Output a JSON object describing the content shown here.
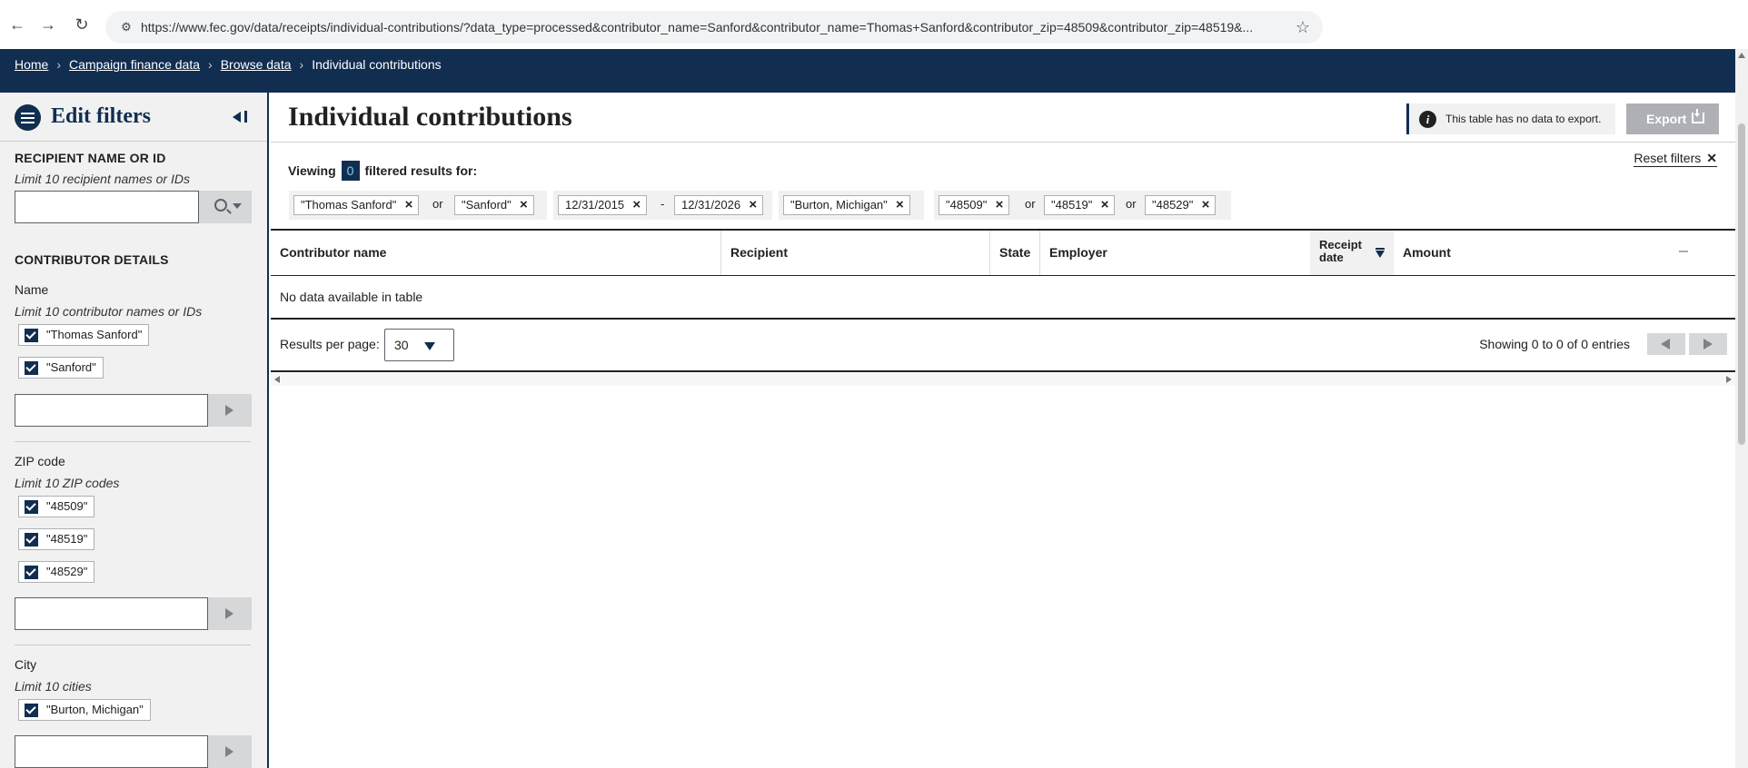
{
  "browser": {
    "url": "https://www.fec.gov/data/receipts/individual-contributions/?data_type=processed&contributor_name=Sanford&contributor_name=Thomas+Sanford&contributor_zip=48509&contributor_zip=48519&..."
  },
  "breadcrumb": {
    "items": [
      "Home",
      "Campaign finance data",
      "Browse data"
    ],
    "current": "Individual contributions"
  },
  "sidebar": {
    "title": "Edit filters",
    "recipient": {
      "heading": "RECIPIENT NAME OR ID",
      "hint": "Limit 10 recipient names or IDs",
      "value": ""
    },
    "contributor": {
      "heading": "CONTRIBUTOR DETAILS",
      "name": {
        "label": "Name",
        "hint": "Limit 10 contributor names or IDs",
        "checked": [
          "\"Thomas Sanford\"",
          "\"Sanford\""
        ],
        "value": ""
      },
      "zip": {
        "label": "ZIP code",
        "hint": "Limit 10 ZIP codes",
        "checked": [
          "\"48509\"",
          "\"48519\"",
          "\"48529\""
        ],
        "value": ""
      },
      "city": {
        "label": "City",
        "hint": "Limit 10 cities",
        "checked": [
          "\"Burton, Michigan\""
        ],
        "value": ""
      }
    }
  },
  "main": {
    "title": "Individual contributions",
    "export_message": "This table has no data to export.",
    "export_label": "Export",
    "viewing_prefix": "Viewing",
    "count": "0",
    "viewing_suffix": "filtered results for:",
    "reset_label": "Reset filters",
    "tags": {
      "names": [
        "\"Thomas Sanford\"",
        "\"Sanford\""
      ],
      "dates": [
        "12/31/2015",
        "12/31/2026"
      ],
      "city": "\"Burton, Michigan\"",
      "zips": [
        "\"48509\"",
        "\"48519\"",
        "\"48529\""
      ],
      "or": "or",
      "dash": "-"
    },
    "table": {
      "columns": [
        "Contributor name",
        "Recipient",
        "State",
        "Employer",
        "Receipt date",
        "Amount"
      ],
      "sort_column": "Receipt date",
      "sort_direction": "descending",
      "empty_message": "No data available in table"
    },
    "pagination": {
      "rpp_label": "Results per page:",
      "rpp_value": "30",
      "showing": "Showing 0 to 0 of 0 entries"
    }
  }
}
